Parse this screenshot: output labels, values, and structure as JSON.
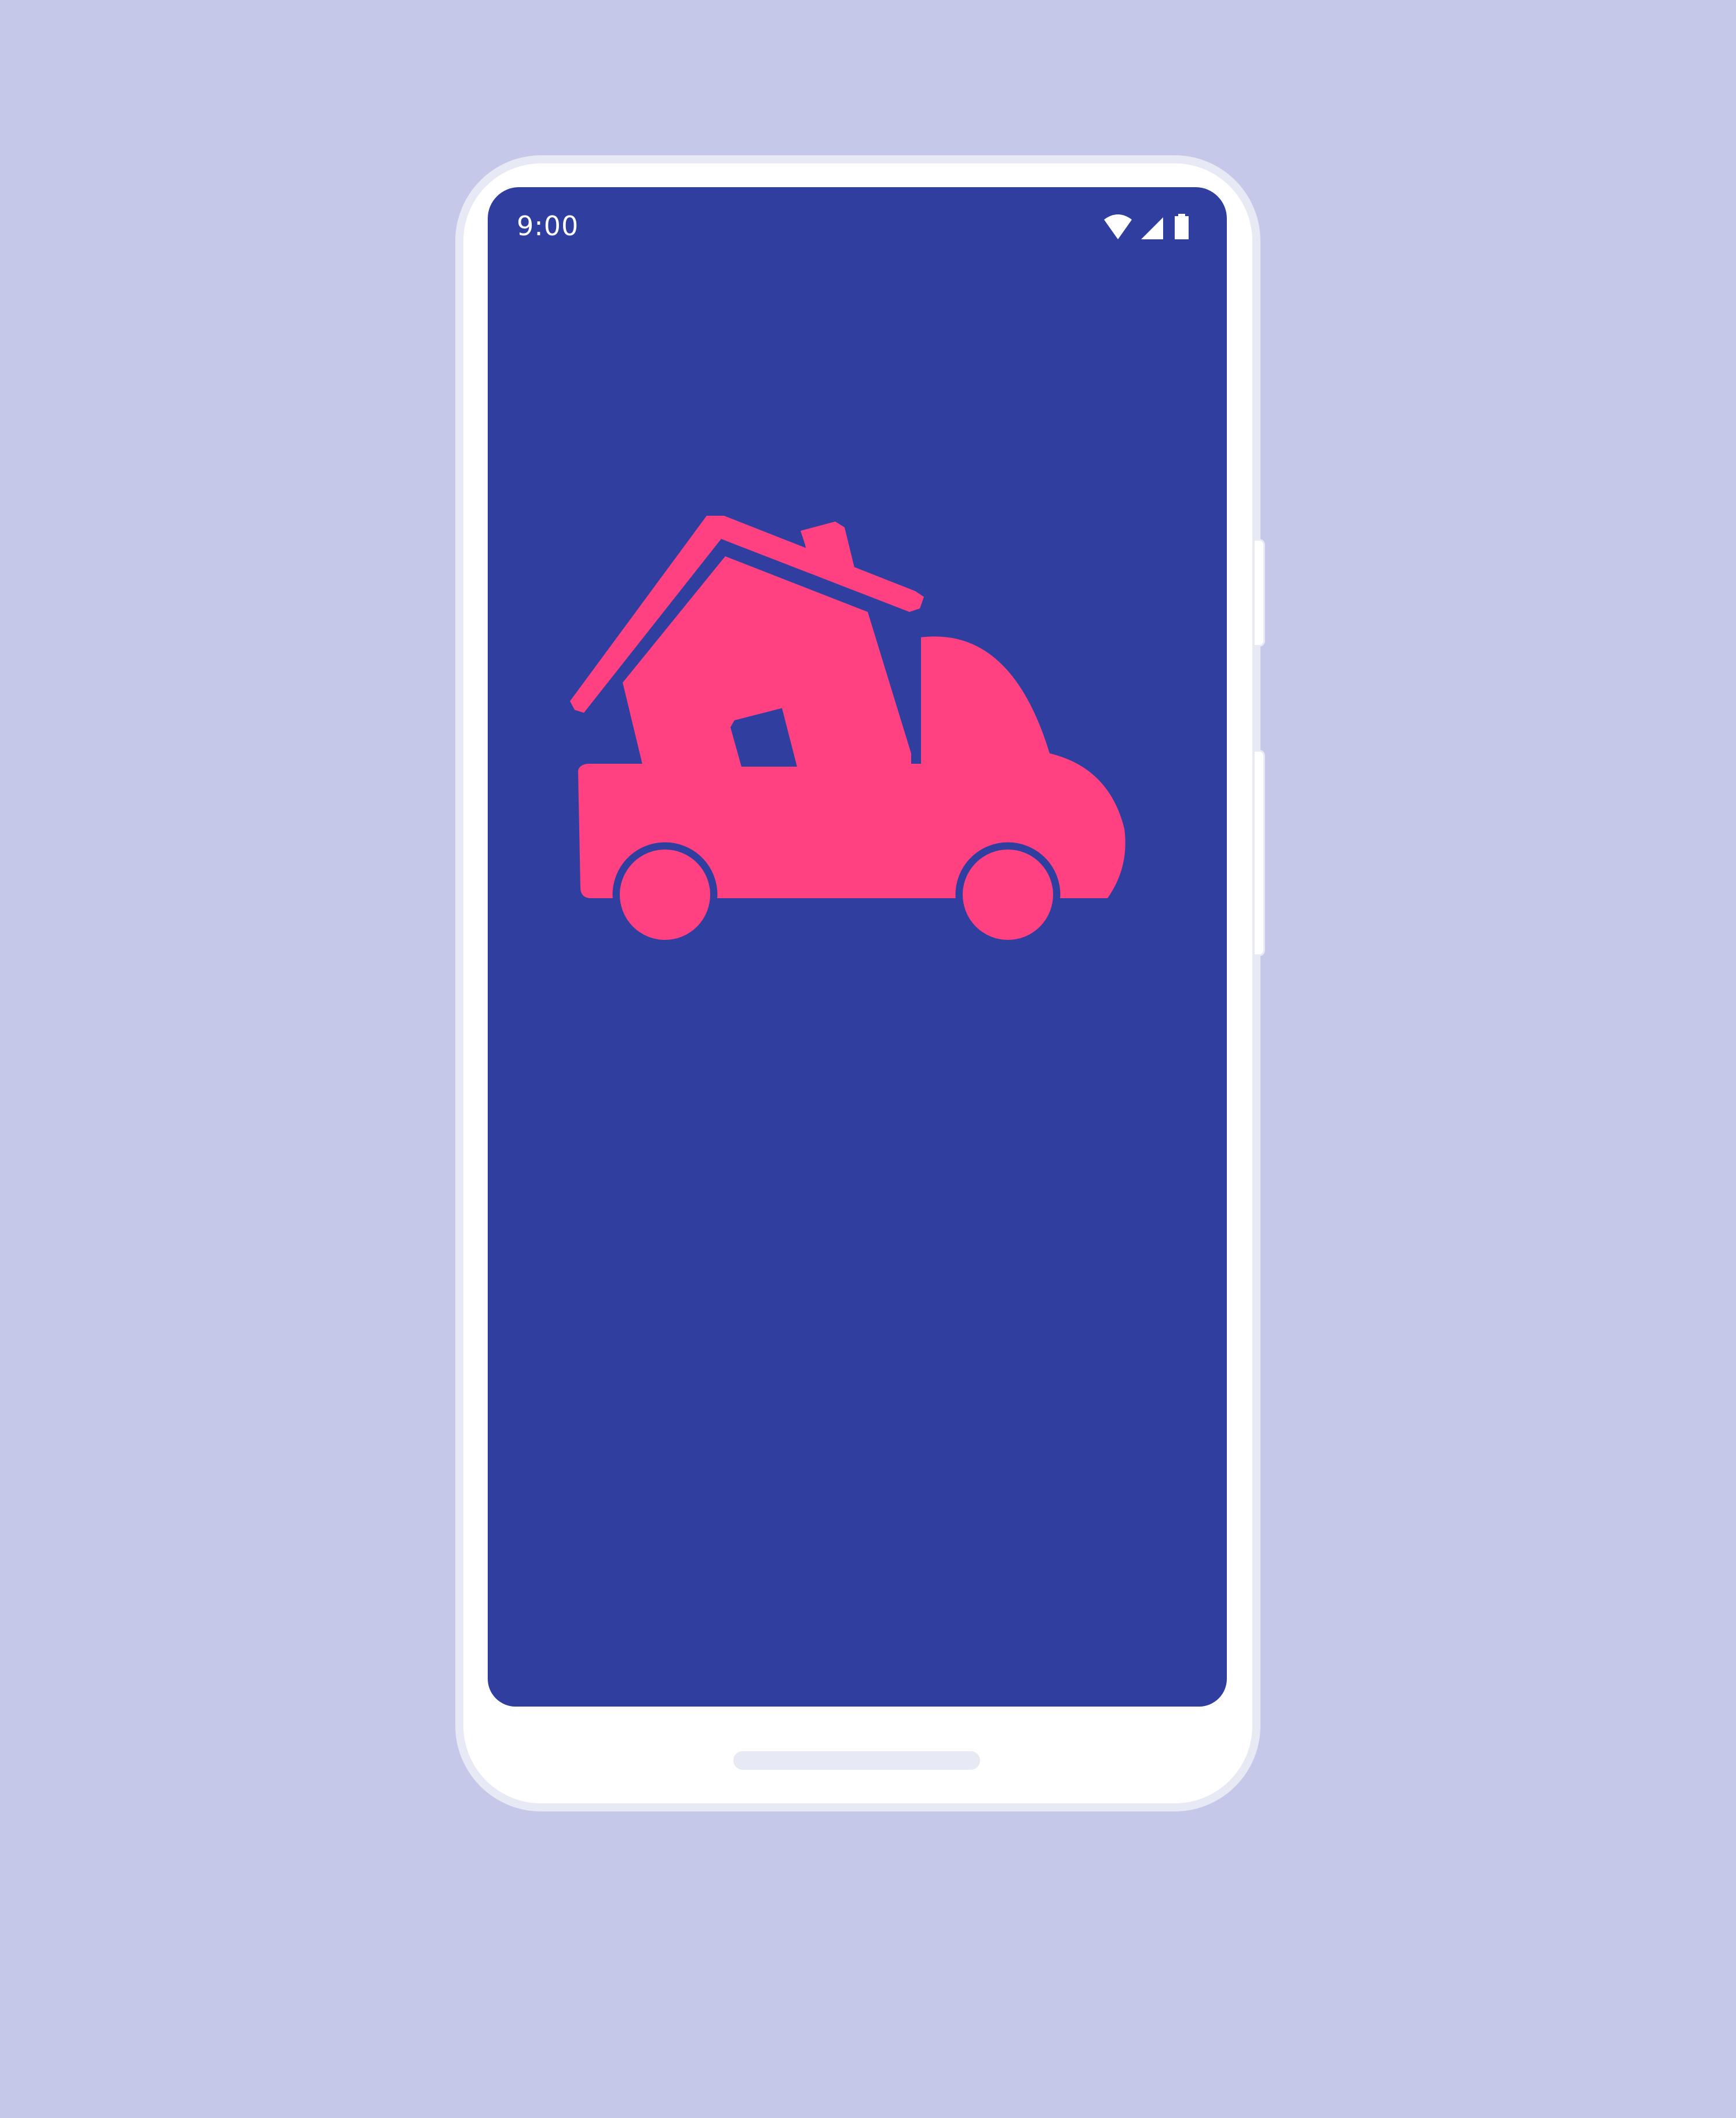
{
  "colors": {
    "background": "#C5C8E8",
    "phone_frame": "#FFFFFF",
    "phone_rim": "#E7E9F4",
    "screen": "#303F9F",
    "accent": "#FF4081",
    "indicator": "#E7E9F4"
  },
  "status_bar": {
    "time": "9:00",
    "icons": [
      "wifi-icon",
      "cellular-signal-icon",
      "battery-icon"
    ]
  },
  "splash": {
    "logo_icon": "moving-truck-with-house-icon"
  }
}
